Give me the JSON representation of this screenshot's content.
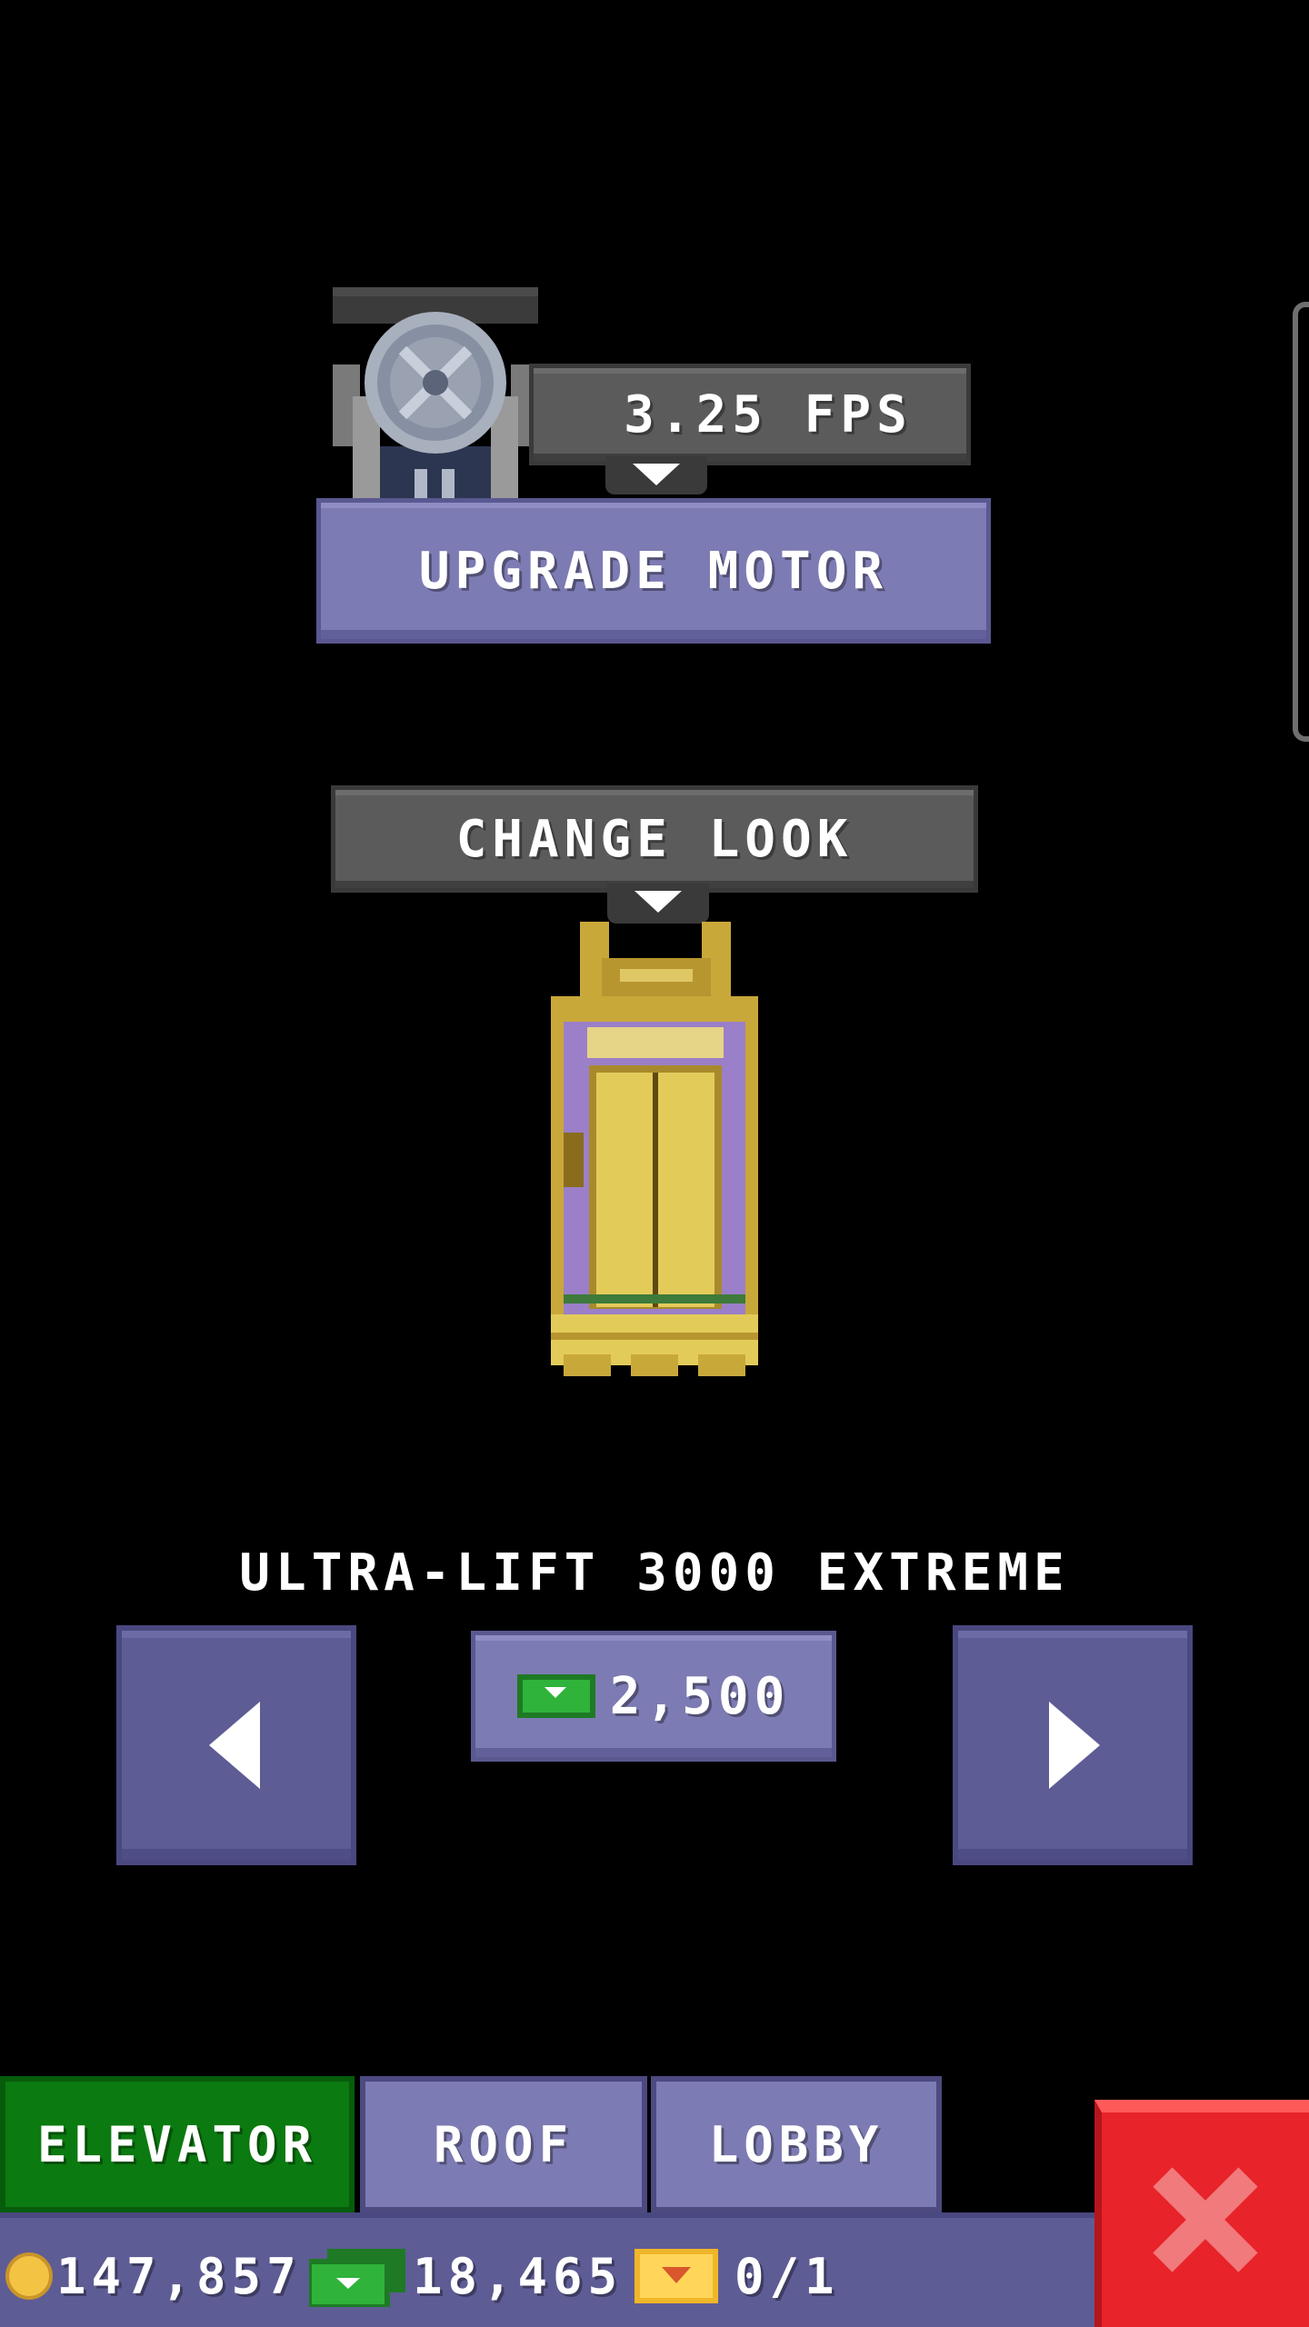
{
  "motor": {
    "speed_label": "3.25 FPS",
    "upgrade_label": "UPGRADE MOTOR"
  },
  "look": {
    "change_label": "CHANGE LOOK",
    "model_name": "ULTRA-LIFT 3000 EXTREME",
    "price": "2,500"
  },
  "tabs": [
    {
      "label": "ELEVATOR",
      "active": true
    },
    {
      "label": "ROOF",
      "active": false
    },
    {
      "label": "LOBBY",
      "active": false
    }
  ],
  "status": {
    "coins": "147,857",
    "bux": "18,465",
    "tickets": "0/1"
  },
  "colors": {
    "active_tab": "#0b7a10",
    "inactive_tab": "#7d7bb3",
    "close": "#e8232a"
  },
  "icons": [
    "motor-wheel-icon",
    "elevator-car-icon",
    "arrow-left-icon",
    "arrow-right-icon",
    "bux-icon",
    "coin-icon",
    "ticket-icon",
    "close-icon"
  ]
}
